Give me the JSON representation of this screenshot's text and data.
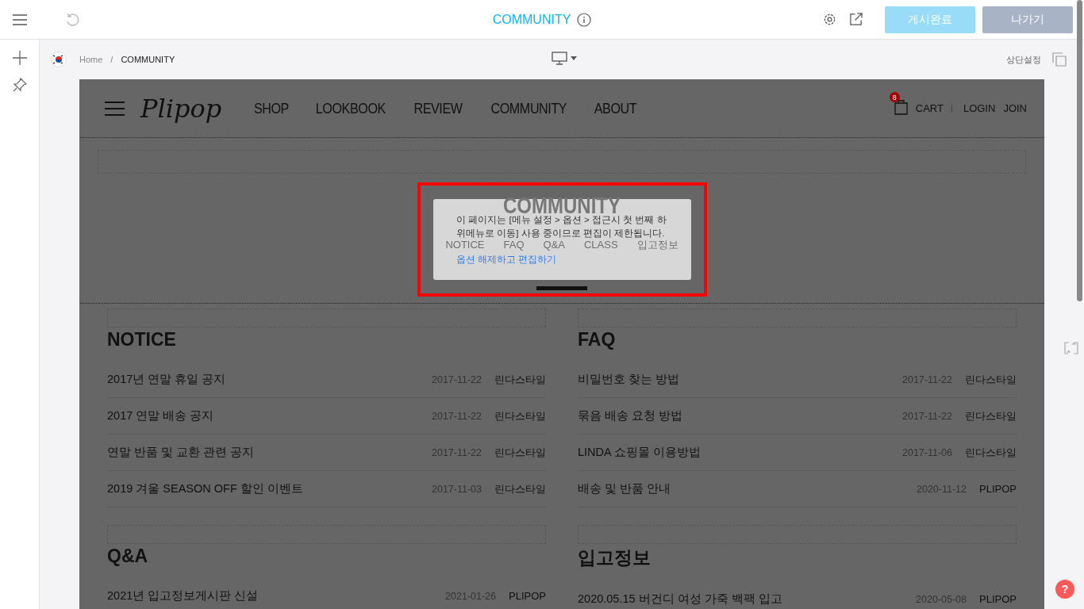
{
  "topbar": {
    "title": "COMMUNITY",
    "publish_button": "게시완료",
    "exit_button": "나가기"
  },
  "breadcrumb": {
    "items": [
      "Home",
      "COMMUNITY"
    ],
    "separator": "/",
    "top_settings": "상단설정"
  },
  "site": {
    "logo": "Plipop",
    "nav": [
      "SHOP",
      "LOOKBOOK",
      "REVIEW",
      "COMMUNITY",
      "ABOUT"
    ],
    "cart_count": "8",
    "cart": "CART",
    "login": "LOGIN",
    "join": "JOIN",
    "hero_title": "COMMUNITY",
    "tabs": [
      "NOTICE",
      "FAQ",
      "Q&A",
      "CLASS",
      "입고정보"
    ],
    "boards": [
      {
        "title": "NOTICE",
        "rows": [
          {
            "title": "2017년 연말 휴일 공지",
            "date": "2017-11-22",
            "author": "린다스타일"
          },
          {
            "title": "2017 연말 배송 공지",
            "date": "2017-11-22",
            "author": "린다스타일"
          },
          {
            "title": "연말 반품 및 교환 관련 공지",
            "date": "2017-11-22",
            "author": "린다스타일"
          },
          {
            "title": "2019 겨울 SEASON OFF 할인 이벤트",
            "date": "2017-11-03",
            "author": "린다스타일"
          }
        ]
      },
      {
        "title": "FAQ",
        "rows": [
          {
            "title": "비밀번호 찾는 방법",
            "date": "2017-11-22",
            "author": "린다스타일"
          },
          {
            "title": "묶음 배송 요청 방법",
            "date": "2017-11-22",
            "author": "린다스타일"
          },
          {
            "title": "LINDA 쇼핑몰 이용방법",
            "date": "2017-11-06",
            "author": "린다스타일"
          },
          {
            "title": "배송 및 반품 안내",
            "date": "2020-11-12",
            "author": "PLIPOP"
          }
        ]
      },
      {
        "title": "Q&A",
        "rows": [
          {
            "title": "2021년 입고정보게시판 신설",
            "date": "2021-01-26",
            "author": "PLIPOP"
          }
        ]
      },
      {
        "title": "입고정보",
        "rows": [
          {
            "title": "2020.05.15 버건디 여성 가죽 백팩 입고",
            "date": "2020-05-08",
            "author": "PLIPOP"
          }
        ]
      }
    ]
  },
  "dialog": {
    "message": "이 페이지는 [메뉴 설정 > 옵션 > 접근시 첫 번째 하위메뉴로 이동] 사용 중이므로 편집이 제한됩니다.",
    "link": "옵션 해제하고 편집하기"
  },
  "help": "?"
}
